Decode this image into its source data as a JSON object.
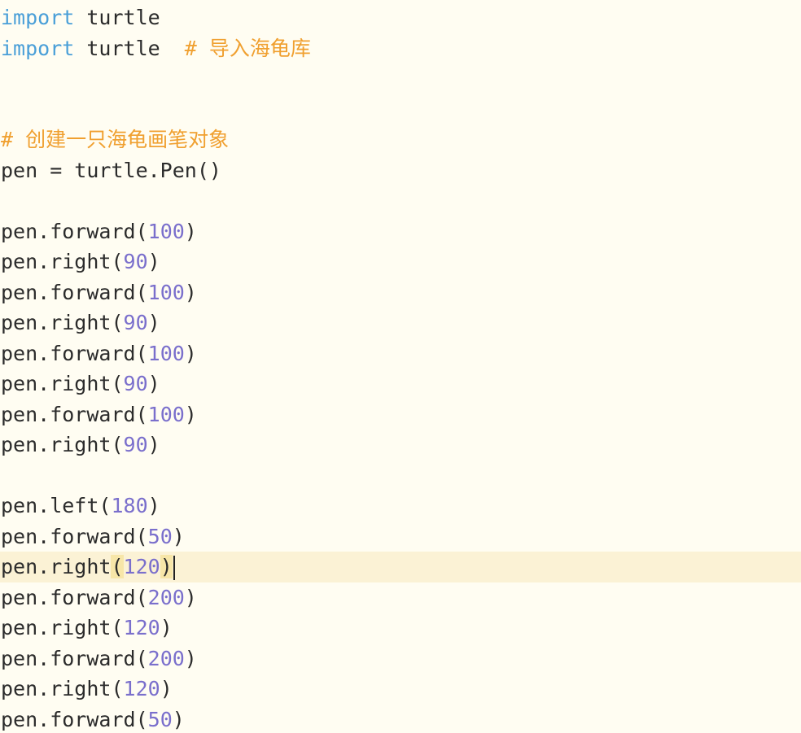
{
  "editor": {
    "lines": [
      {
        "type": "import",
        "keyword": "import",
        "module": "turtle",
        "comment": ""
      },
      {
        "type": "import",
        "keyword": "import",
        "module": "turtle",
        "comment": "# 导入海龟库"
      },
      {
        "type": "blank"
      },
      {
        "type": "blank"
      },
      {
        "type": "comment",
        "text": "# 创建一只海龟画笔对象"
      },
      {
        "type": "assign",
        "text": "pen = turtle.Pen()"
      },
      {
        "type": "blank"
      },
      {
        "type": "call",
        "func": "pen.forward",
        "arg": "100"
      },
      {
        "type": "call",
        "func": "pen.right",
        "arg": "90"
      },
      {
        "type": "call",
        "func": "pen.forward",
        "arg": "100"
      },
      {
        "type": "call",
        "func": "pen.right",
        "arg": "90"
      },
      {
        "type": "call",
        "func": "pen.forward",
        "arg": "100"
      },
      {
        "type": "call",
        "func": "pen.right",
        "arg": "90"
      },
      {
        "type": "call",
        "func": "pen.forward",
        "arg": "100"
      },
      {
        "type": "call",
        "func": "pen.right",
        "arg": "90"
      },
      {
        "type": "blank"
      },
      {
        "type": "call",
        "func": "pen.left",
        "arg": "180"
      },
      {
        "type": "call",
        "func": "pen.forward",
        "arg": "50"
      },
      {
        "type": "call",
        "func": "pen.right",
        "arg": "120",
        "current": true
      },
      {
        "type": "call",
        "func": "pen.forward",
        "arg": "200"
      },
      {
        "type": "call",
        "func": "pen.right",
        "arg": "120"
      },
      {
        "type": "call",
        "func": "pen.forward",
        "arg": "200"
      },
      {
        "type": "call",
        "func": "pen.right",
        "arg": "120"
      },
      {
        "type": "call",
        "func": "pen.forward",
        "arg": "50"
      }
    ]
  },
  "colors": {
    "background": "#fffdf2",
    "current_line": "#fbf2d5",
    "keyword": "#4a9fd8",
    "comment": "#f0a030",
    "number": "#7a6fcc",
    "text": "#2b2b2b"
  }
}
